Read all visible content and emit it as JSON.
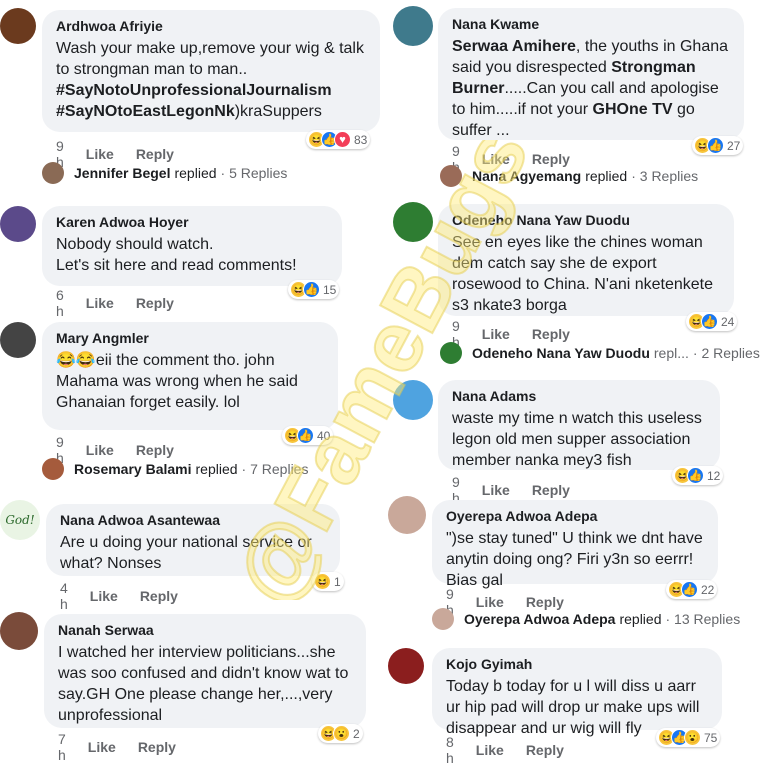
{
  "watermark_text": "@FameBugs",
  "comments": [
    {
      "name": "Ardhwoa Afriyie",
      "text": "Wash your make up,remove your wig & talk to strongman man to man..\n",
      "tags": [
        "#SayNotoUnprofessionalJournalism",
        "#SayNOtoEastLegonNk"
      ],
      "tail": ")kraSuppers",
      "time": "9 h",
      "like": "Like",
      "reply": "Reply",
      "reactions": [
        "haha",
        "like",
        "love"
      ],
      "count": "83",
      "replies": {
        "name": "Jennifer Begel",
        "word": "replied",
        "count": "· 5 Replies"
      }
    },
    {
      "name": "Karen Adwoa Hoyer",
      "text": "Nobody should watch.\nLet's sit here and read comments!",
      "time": "6 h",
      "like": "Like",
      "reply": "Reply",
      "reactions": [
        "haha",
        "like"
      ],
      "count": "15"
    },
    {
      "name": "Mary Angmler",
      "emoji": "😂😂",
      "text": "eii the comment tho. john Mahama was wrong when he said Ghanaian forget easily. lol",
      "time": "9 h",
      "like": "Like",
      "reply": "Reply",
      "reactions": [
        "haha",
        "like"
      ],
      "count": "40",
      "replies": {
        "name": "Rosemary Balami",
        "word": "replied",
        "count": "· 7 Replies"
      }
    },
    {
      "name": "Nana Adwoa Asantewaa",
      "avatar_text": "God!",
      "text": "Are u doing your national service or what? Nonses",
      "time": "4 h",
      "like": "Like",
      "reply": "Reply",
      "reactions": [
        "haha"
      ],
      "count": "1"
    },
    {
      "name": "Nanah Serwaa",
      "text": "I watched her interview politicians...she was soo confused and didn't know wat to say.GH One please change her,...,very unprofessional",
      "time": "7 h",
      "like": "Like",
      "reply": "Reply",
      "reactions": [
        "haha",
        "wow"
      ],
      "count": "2"
    },
    {
      "name": "Nana Kwame",
      "b1": "Serwaa Amihere",
      "t1": ", the youths in Ghana said you disrespected ",
      "b2": "Strongman Burner",
      "t2": ".....Can you call and apologise to him.....if not your ",
      "b3": "GHOne TV",
      "t3": " go suffer ...",
      "time": "9 h",
      "like": "Like",
      "reply": "Reply",
      "reactions": [
        "haha",
        "like"
      ],
      "count": "27",
      "replies": {
        "name": "Nana Agyemang",
        "word": "replied",
        "count": "· 3 Replies"
      }
    },
    {
      "name": "Odeneho Nana Yaw Duodu",
      "text": "See en eyes like the chines woman dem catch say she de export rosewood to China.  N'ani nketenkete s3 nkate3 borga",
      "time": "9 h",
      "like": "Like",
      "reply": "Reply",
      "reactions": [
        "haha",
        "like"
      ],
      "count": "24",
      "replies": {
        "name": "Odeneho Nana Yaw Duodu",
        "word": "repl...",
        "count": "· 2 Replies"
      }
    },
    {
      "name": "Nana Adams",
      "text": "waste my time n watch this useless legon old men supper association member nanka mey3 fish",
      "time": "9 h",
      "like": "Like",
      "reply": "Reply",
      "reactions": [
        "haha",
        "like"
      ],
      "count": "12"
    },
    {
      "name": "Oyerepa Adwoa Adepa",
      "text": "\")se stay tuned\" U think we dnt have anytin doing ong?  Firi y3n so eerrr! Bias gal",
      "time": "9 h",
      "like": "Like",
      "reply": "Reply",
      "reactions": [
        "haha",
        "like"
      ],
      "count": "22",
      "replies": {
        "name": "Oyerepa Adwoa Adepa",
        "word": "replied",
        "count": "· 13 Replies"
      }
    },
    {
      "name": "Kojo Gyimah",
      "text": "Today b today for u l will diss u aarr ur hip pad will drop ur make ups will disappear and ur wig will fly",
      "time": "8 h",
      "like": "Like",
      "reply": "Reply",
      "reactions": [
        "haha",
        "like",
        "wow"
      ],
      "count": "75"
    }
  ],
  "colors": {
    "bubble": "#f0f2f5",
    "like": "#1877f2",
    "love": "#f33e58",
    "haha": "#f7c53c",
    "meta": "#65676b"
  }
}
